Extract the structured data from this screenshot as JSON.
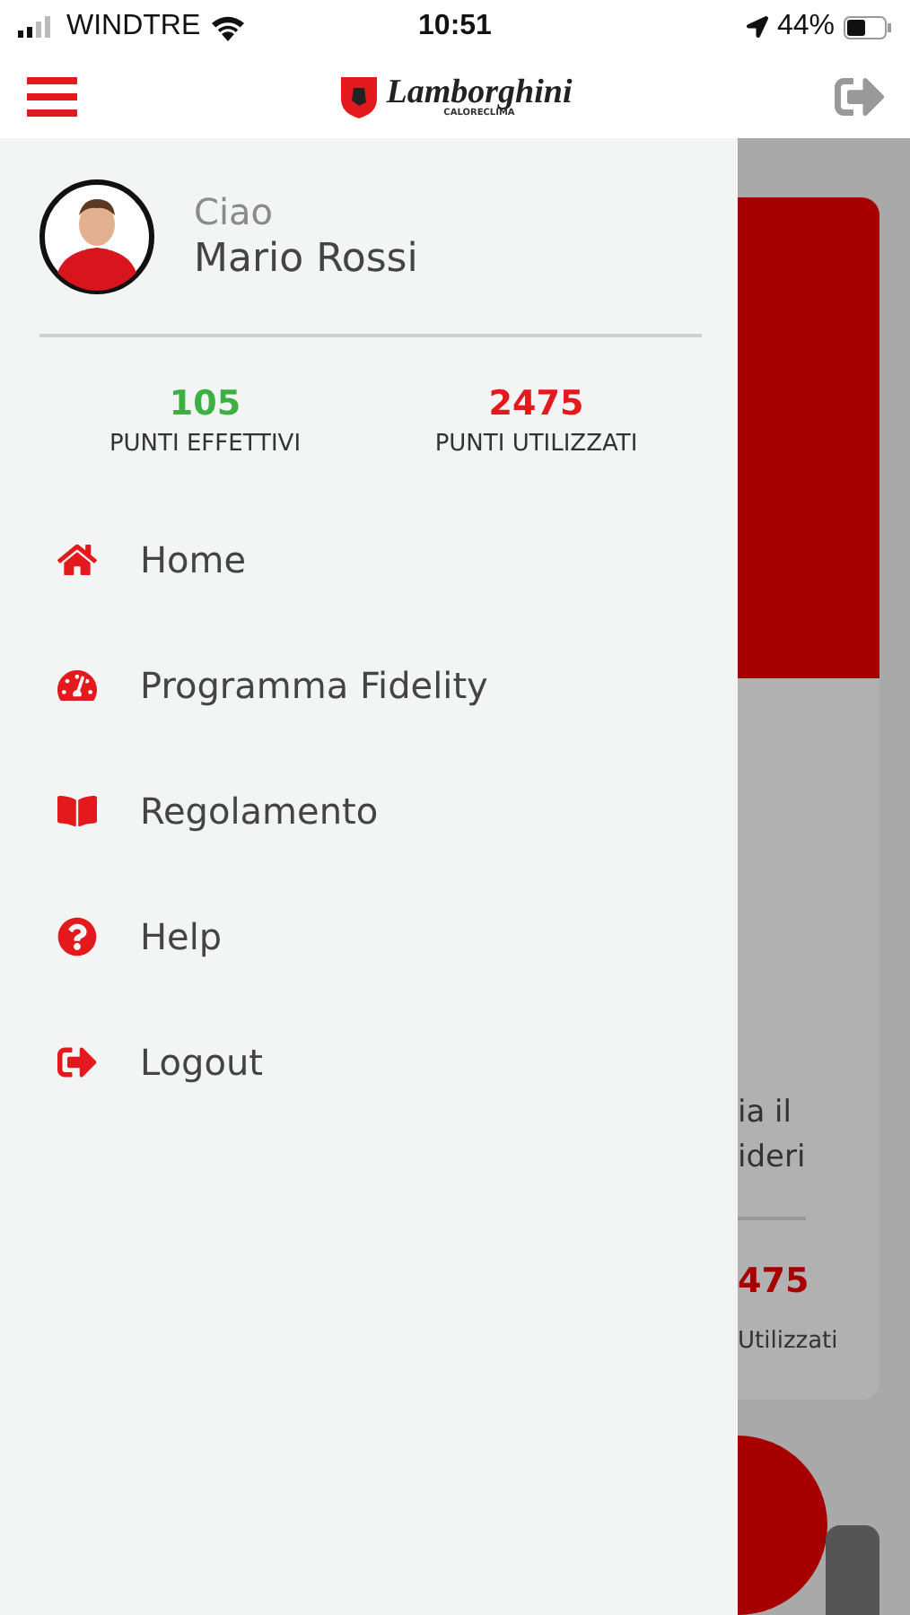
{
  "status_bar": {
    "carrier": "WINDTRE",
    "time": "10:51",
    "battery": "44%"
  },
  "header": {
    "logo": {
      "name": "Lamborghini",
      "sub": "CALORECLIMA"
    }
  },
  "drawer": {
    "greeting": "Ciao",
    "user_name": "Mario Rossi",
    "points": [
      {
        "value": "105",
        "label": "PUNTI EFFETTIVI",
        "color": "#3cb043"
      },
      {
        "value": "2475",
        "label": "PUNTI UTILIZZATI",
        "color": "#e3191e"
      }
    ],
    "menu": [
      {
        "label": "Home"
      },
      {
        "label": "Programma Fidelity"
      },
      {
        "label": "Regolamento"
      },
      {
        "label": "Help"
      },
      {
        "label": "Logout"
      }
    ]
  },
  "background_page": {
    "text_lines": [
      "ia il",
      "ideri"
    ],
    "points_value": "475",
    "points_label": "Utilizzati"
  }
}
